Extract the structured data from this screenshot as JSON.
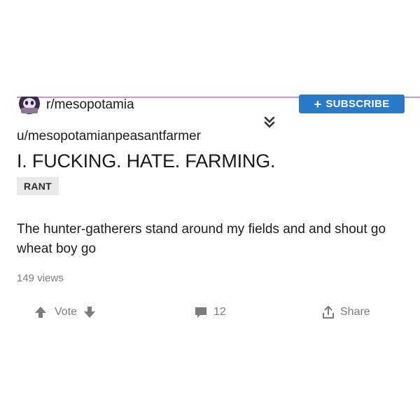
{
  "community": {
    "name": "r/mesopotamia",
    "icon": "community-avatar-icon"
  },
  "subscribe": {
    "plus": "+",
    "label": "SUBSCRIBE",
    "color": "#2b79c9"
  },
  "collapse": {
    "icon": "double-chevron-down-icon"
  },
  "post": {
    "author": "u/mesopotamianpeasantfarmer",
    "title": "I. FUCKING. HATE. FARMING.",
    "flair": "RANT",
    "body": "The hunter-gatherers stand around my fields and and shout go wheat boy go",
    "views": "149 views"
  },
  "actions": {
    "vote_label": "Vote",
    "upvote_icon": "upvote-arrow-icon",
    "downvote_icon": "downvote-arrow-icon",
    "comment_icon": "comment-icon",
    "comment_count": "12",
    "share_icon": "share-icon",
    "share_label": "Share"
  },
  "colors": {
    "accent_line": "#c89ac6",
    "muted_text": "#7c7c7c",
    "flair_bg": "#e9e9e9"
  }
}
